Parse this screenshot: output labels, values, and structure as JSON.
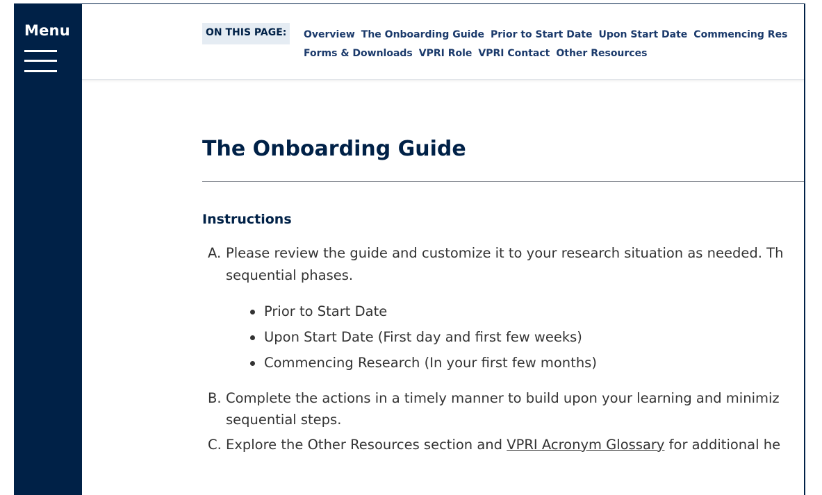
{
  "sidebar": {
    "menu_label": "Menu"
  },
  "on_this_page": {
    "label": "ON THIS PAGE:",
    "links_row1": [
      "Overview",
      "The Onboarding Guide",
      "Prior to Start Date",
      "Upon Start Date",
      "Commencing Res"
    ],
    "links_row2": [
      "Forms & Downloads",
      "VPRI Role",
      "VPRI Contact",
      "Other Resources"
    ]
  },
  "main": {
    "title": "The Onboarding Guide",
    "subhead": "Instructions",
    "item_a": {
      "marker": "A.",
      "line1": "Please review the guide and customize it to your research situation as needed. Th",
      "line2": "sequential phases."
    },
    "bullets": [
      "Prior to Start Date",
      "Upon Start Date (First day and first few weeks)",
      "Commencing Research (In your first few months)"
    ],
    "item_b": {
      "marker": "B.",
      "line1": "Complete the actions in a timely manner to build upon your learning and minimiz",
      "line2": "sequential steps."
    },
    "item_c": {
      "marker": "C.",
      "before": "Explore the Other Resources section and ",
      "link": "VPRI Acronym Glossary",
      "after": " for additional he"
    }
  },
  "colors": {
    "navy": "#002147",
    "link": "#1b3a6b",
    "body_text": "#333333",
    "tag_bg": "#e5ecf3"
  },
  "icons": {
    "menu": "hamburger-icon"
  }
}
